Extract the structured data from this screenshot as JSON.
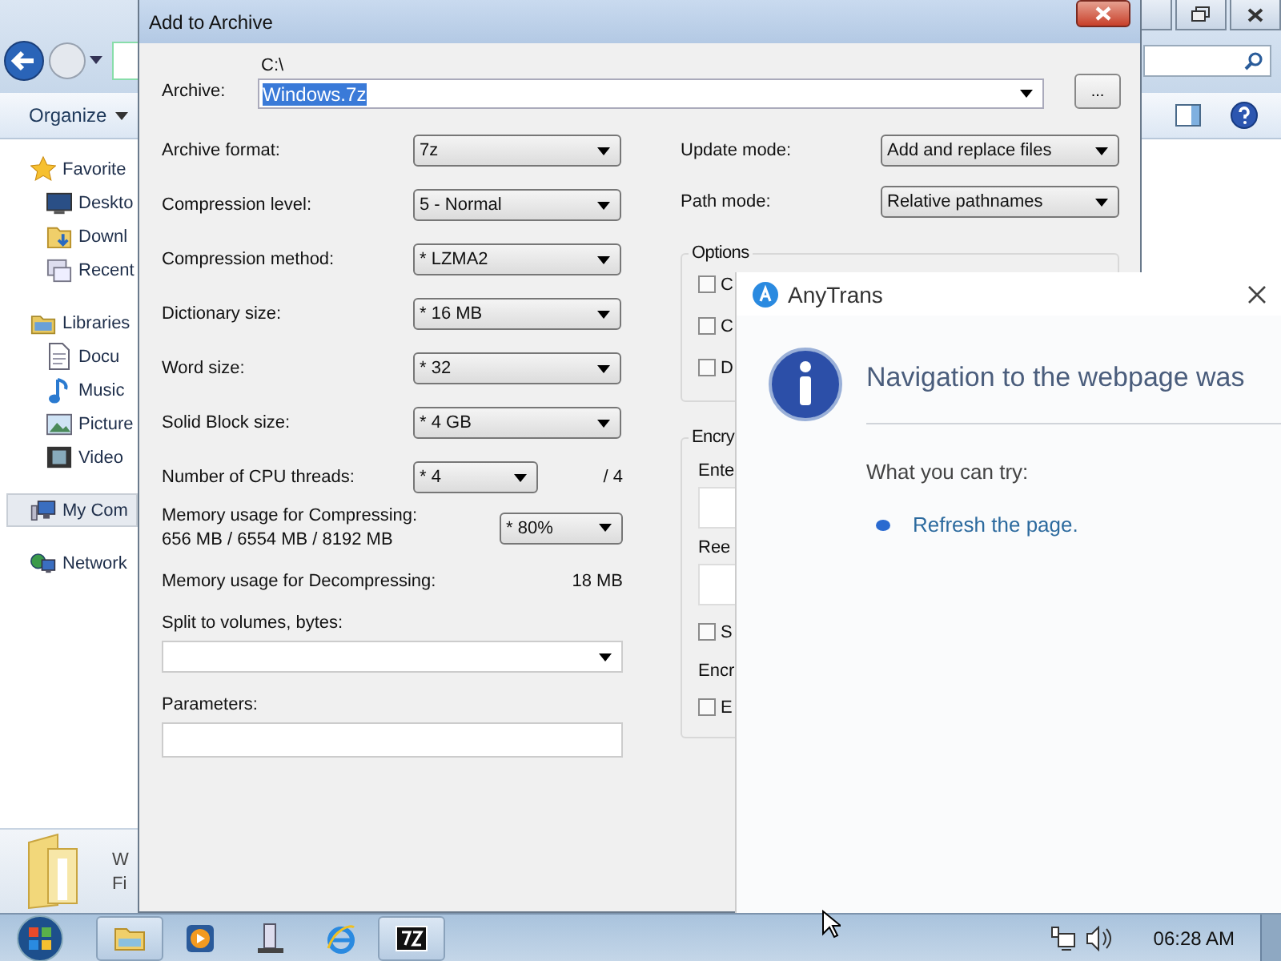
{
  "explorer": {
    "toolbar": {
      "organize": "Organize"
    },
    "nav_items": [
      {
        "kind": "star",
        "label": "Favorite",
        "selected": false
      },
      {
        "kind": "desktop",
        "label": "Deskto",
        "selected": false
      },
      {
        "kind": "download",
        "label": "Downl",
        "selected": false
      },
      {
        "kind": "recent",
        "label": "Recent",
        "selected": false
      },
      {
        "kind": "library",
        "label": "Libraries",
        "selected": false
      },
      {
        "kind": "document",
        "label": "Docu",
        "selected": false
      },
      {
        "kind": "music",
        "label": "Music",
        "selected": false
      },
      {
        "kind": "picture",
        "label": "Picture",
        "selected": false
      },
      {
        "kind": "video",
        "label": "Video",
        "selected": false
      },
      {
        "kind": "computer",
        "label": "My Com",
        "selected": true
      },
      {
        "kind": "network",
        "label": "Network",
        "selected": false
      }
    ],
    "details": [
      "W",
      "Fi"
    ]
  },
  "dialog": {
    "title": "Add to Archive",
    "archive": {
      "label": "Archive:",
      "path": "C:\\",
      "value": "Windows.7z"
    },
    "browse_button": "...",
    "settings": [
      {
        "label": "Archive format:",
        "value": "7z"
      },
      {
        "label": "Compression level:",
        "value": "5 - Normal"
      },
      {
        "label": "Compression method:",
        "value": "* LZMA2"
      },
      {
        "label": "Dictionary size:",
        "value": "* 16 MB"
      },
      {
        "label": "Word size:",
        "value": "* 32"
      },
      {
        "label": "Solid Block size:",
        "value": "* 4 GB"
      },
      {
        "label": "Number of CPU threads:",
        "value": "* 4",
        "suffix": "/ 4"
      }
    ],
    "memory_compress": {
      "label": "Memory usage for Compressing:",
      "detail": "656 MB / 6554 MB / 8192 MB",
      "value": "* 80%"
    },
    "memory_decompress": {
      "label": "Memory usage for Decompressing:",
      "value": "18 MB"
    },
    "split": {
      "label": "Split to volumes, bytes:"
    },
    "parameters": {
      "label": "Parameters:"
    },
    "modes": [
      {
        "label": "Update mode:",
        "value": "Add and replace files"
      },
      {
        "label": "Path mode:",
        "value": "Relative pathnames"
      }
    ],
    "options": {
      "title": "Options",
      "checkboxes": [
        {
          "label": "C",
          "checked": false
        },
        {
          "label": "C",
          "checked": false
        },
        {
          "label": "D",
          "checked": false
        }
      ]
    },
    "encryption": {
      "title": "Encry",
      "password_label": "Ente",
      "reenter_label": "Ree",
      "show_password": {
        "label": "S",
        "checked": false
      },
      "method_label": "Encr",
      "encrypt_names": {
        "label": "E",
        "checked": false
      }
    }
  },
  "popup": {
    "app": "AnyTrans",
    "heading": "Navigation to the webpage was",
    "try_label": "What you can try:",
    "suggestions": [
      "Refresh the page."
    ]
  },
  "taskbar": {
    "items": [
      {
        "kind": "explorer",
        "selected": true
      },
      {
        "kind": "media",
        "selected": false
      },
      {
        "kind": "server",
        "selected": false
      },
      {
        "kind": "browser",
        "selected": false
      },
      {
        "kind": "archiver",
        "selected": true
      }
    ],
    "clock": "06:28 AM"
  }
}
